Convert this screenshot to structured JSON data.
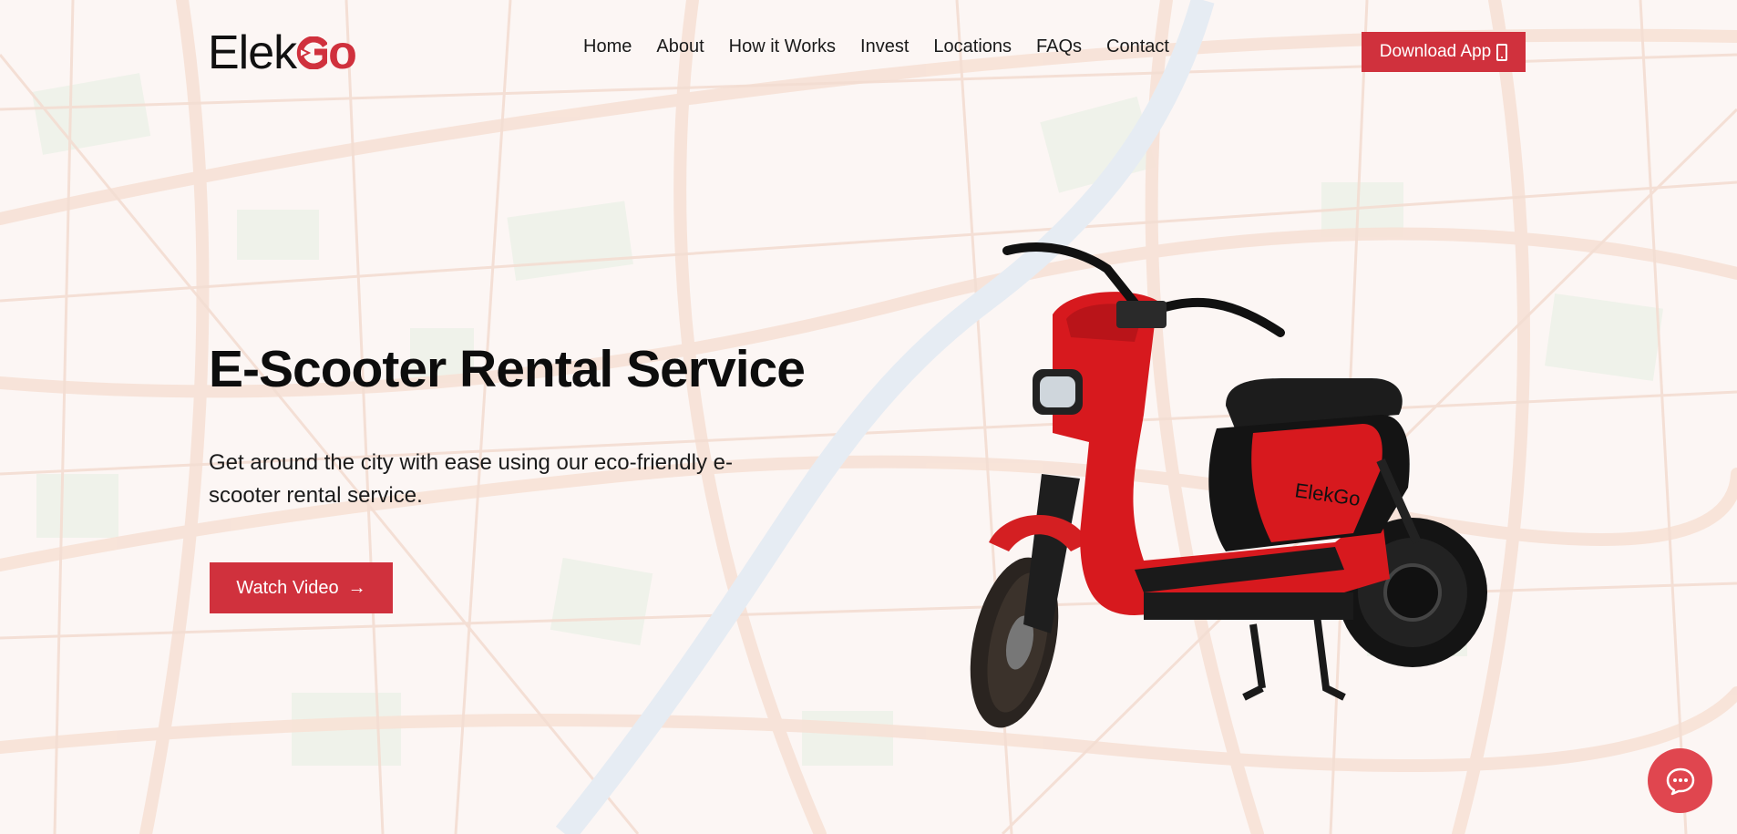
{
  "logo": {
    "part1": "Elek",
    "part2": "Go"
  },
  "nav": {
    "items": [
      "Home",
      "About",
      "How it Works",
      "Invest",
      "Locations",
      "FAQs",
      "Contact"
    ]
  },
  "header": {
    "download_label": "Download App"
  },
  "hero": {
    "title": "E-Scooter Rental Service",
    "subtitle": "Get around the city with ease using our eco-friendly e-scooter rental service.",
    "watch_label": "Watch Video"
  },
  "scooter_brand": "ElekGo",
  "icons": {
    "download": "phone-icon",
    "watch": "arrow-right-icon",
    "chat": "chat-bubble-icon"
  },
  "colors": {
    "brand_red": "#d0313d",
    "background": "#fdf6f4"
  }
}
